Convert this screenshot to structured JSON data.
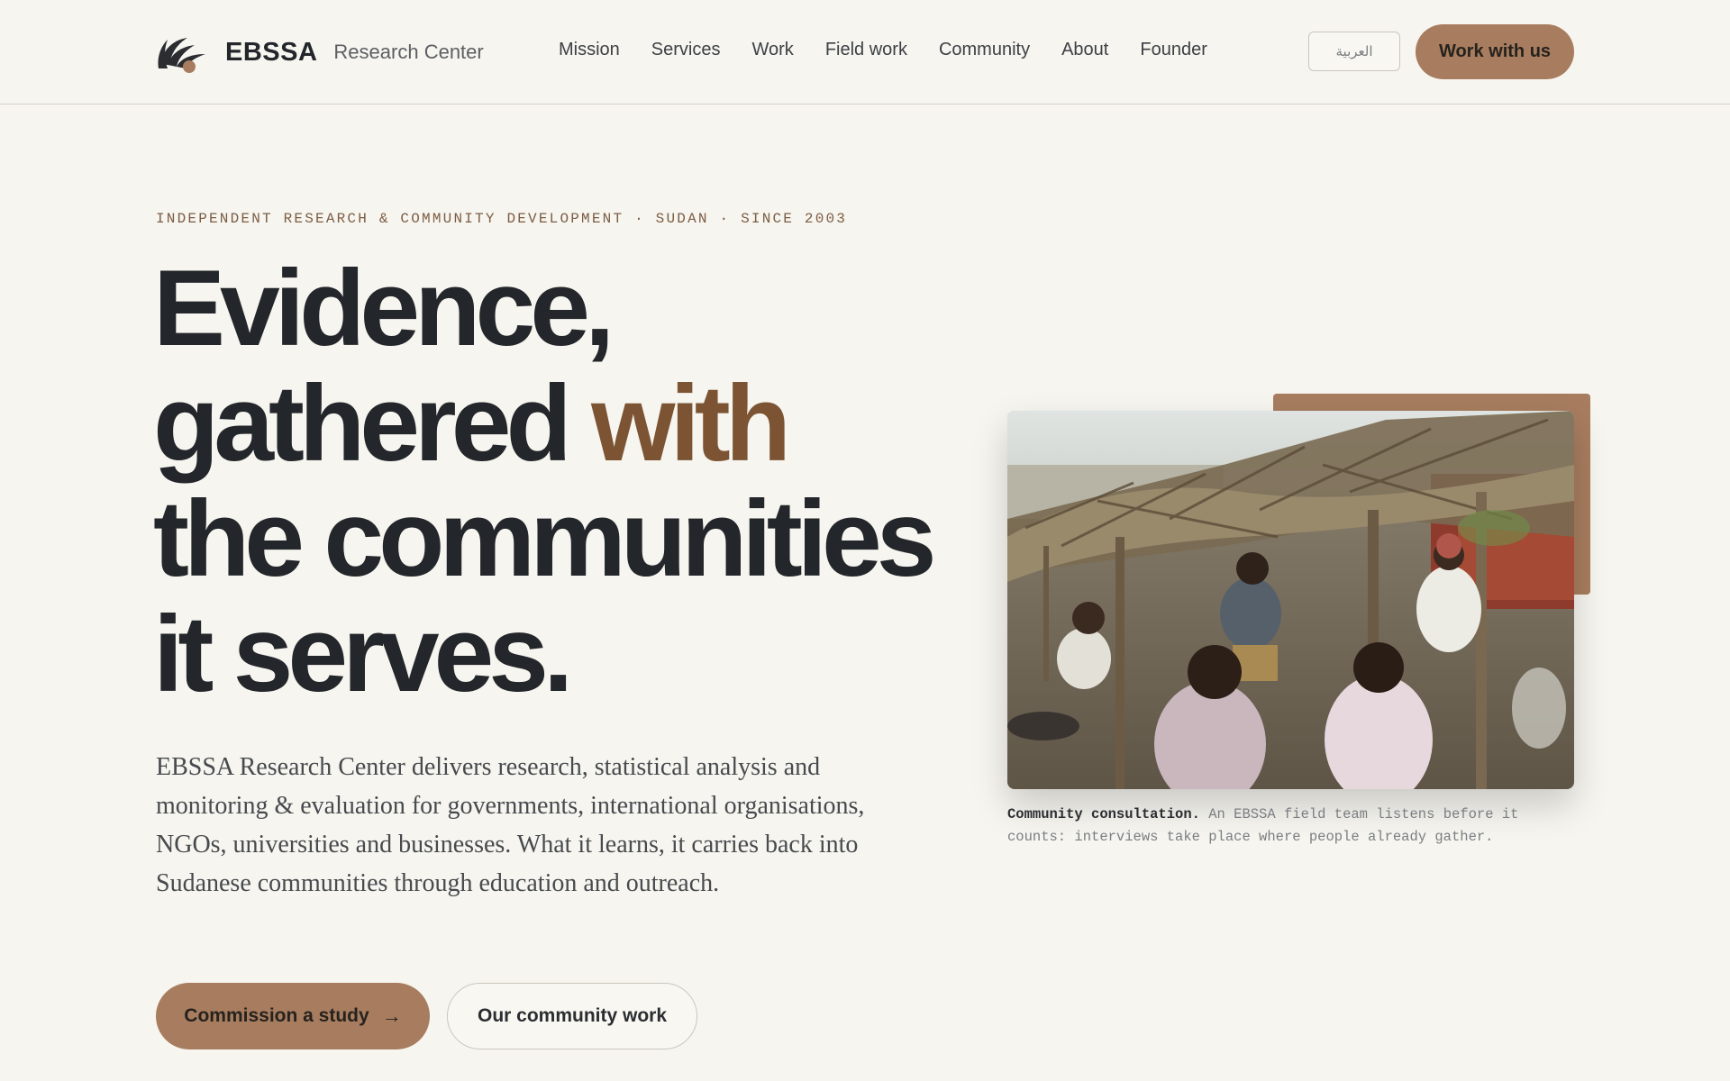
{
  "brand": {
    "name": "EBSSA",
    "subtitle": "Research Center",
    "logo_icon": "sunburst-arc-logo-icon"
  },
  "nav": {
    "items": [
      "Mission",
      "Services",
      "Work",
      "Field work",
      "Community",
      "About",
      "Founder"
    ]
  },
  "header": {
    "lang_label": "العربية",
    "cta_label": "Work with us"
  },
  "hero": {
    "eyebrow": "INDEPENDENT RESEARCH & COMMUNITY DEVELOPMENT · SUDAN · SINCE 2003",
    "headline_line1": "Evidence,",
    "headline_line2a": "gathered ",
    "headline_line2b": "with",
    "headline_line3": "the communities",
    "headline_line4": "it serves.",
    "lede": "EBSSA Research Center delivers research, statistical analysis and monitoring & evaluation for governments, international organisations, NGOs, universities and businesses. What it learns, it carries back into Sudanese communities through education and outreach.",
    "primary_cta": "Commission a study",
    "primary_cta_icon": "arrow-right-icon",
    "secondary_cta": "Our community work"
  },
  "figure": {
    "caption_title": "Community consultation.",
    "caption_text": "An EBSSA field team listens before it counts: interviews take place where people already gather."
  },
  "colors": {
    "background": "#f6f5ef",
    "accent": "#a87d5f",
    "accent_text": "#7c5434",
    "ink": "#23262a"
  }
}
